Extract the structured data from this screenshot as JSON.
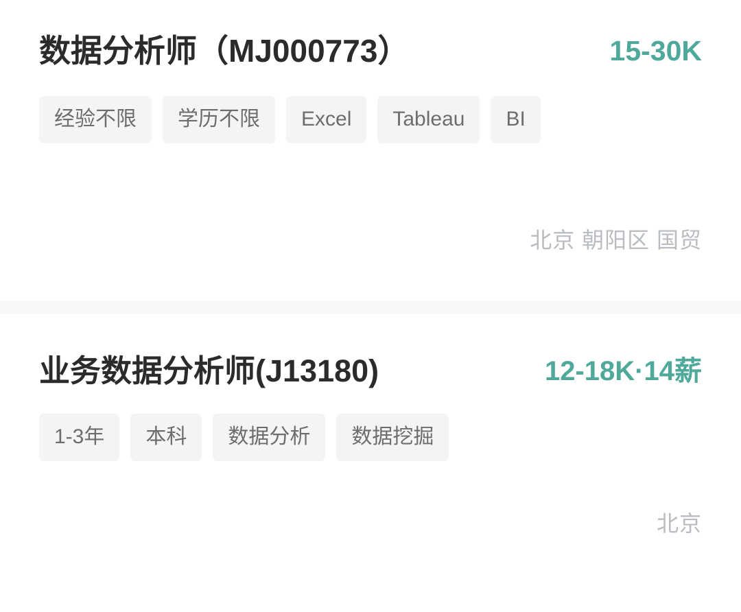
{
  "theme": {
    "page_background": "#ffffff",
    "salary_accent": "#4fa99b",
    "title_color": "#2b2b2b",
    "tag_background": "#f3f4f6",
    "tag_text": "#6d6d6d",
    "location_text": "#b9bcc0",
    "separator_color": "#f6f7f8"
  },
  "jobs": [
    {
      "title": "数据分析师（MJ000773）",
      "salary": "15-30K",
      "tags": [
        "经验不限",
        "学历不限",
        "Excel",
        "Tableau",
        "BI"
      ],
      "location": "北京 朝阳区 国贸"
    },
    {
      "title": "业务数据分析师(J13180)",
      "salary": "12-18K·14薪",
      "tags": [
        "1-3年",
        "本科",
        "数据分析",
        "数据挖掘"
      ],
      "location": "北京"
    }
  ]
}
